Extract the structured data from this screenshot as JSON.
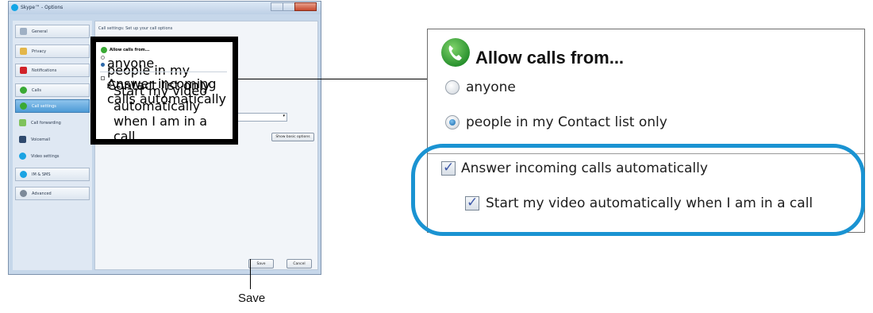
{
  "window": {
    "title": "Skype™ - Options",
    "nav": [
      {
        "label": "General"
      },
      {
        "label": "Privacy"
      },
      {
        "label": "Notifications"
      },
      {
        "label": "Calls"
      },
      {
        "label": "Call settings"
      },
      {
        "label": "Call forwarding"
      },
      {
        "label": "Voicemail"
      },
      {
        "label": "Video settings"
      },
      {
        "label": "IM & SMS"
      },
      {
        "label": "Advanced"
      }
    ],
    "content_header": "Call settings: Set up your call options",
    "allow_title": "Allow calls from...",
    "option_anyone": "anyone",
    "option_contacts": "people in my Contact list only",
    "answer_auto": "Answer incoming calls automatically",
    "video_auto": "Start my video automatically when I am in a call",
    "emergency_label": "For emergency calls, my default location is:",
    "show_basic": "Show basic options",
    "save": "Save",
    "cancel": "Cancel"
  },
  "zoom": {
    "title": "Allow calls from...",
    "option_anyone": "anyone",
    "option_contacts": "people in my Contact list only",
    "option_contacts_selected": true,
    "answer_auto": "Answer incoming calls automatically",
    "answer_auto_checked": true,
    "video_auto": "Start my video automatically when I am in a call",
    "video_auto_checked": true
  },
  "callout": {
    "save_caption": "Save"
  },
  "colors": {
    "highlight_oval": "#1a93d2",
    "skype_green": "#3aa935",
    "selected_nav": "#4d9bd6"
  }
}
